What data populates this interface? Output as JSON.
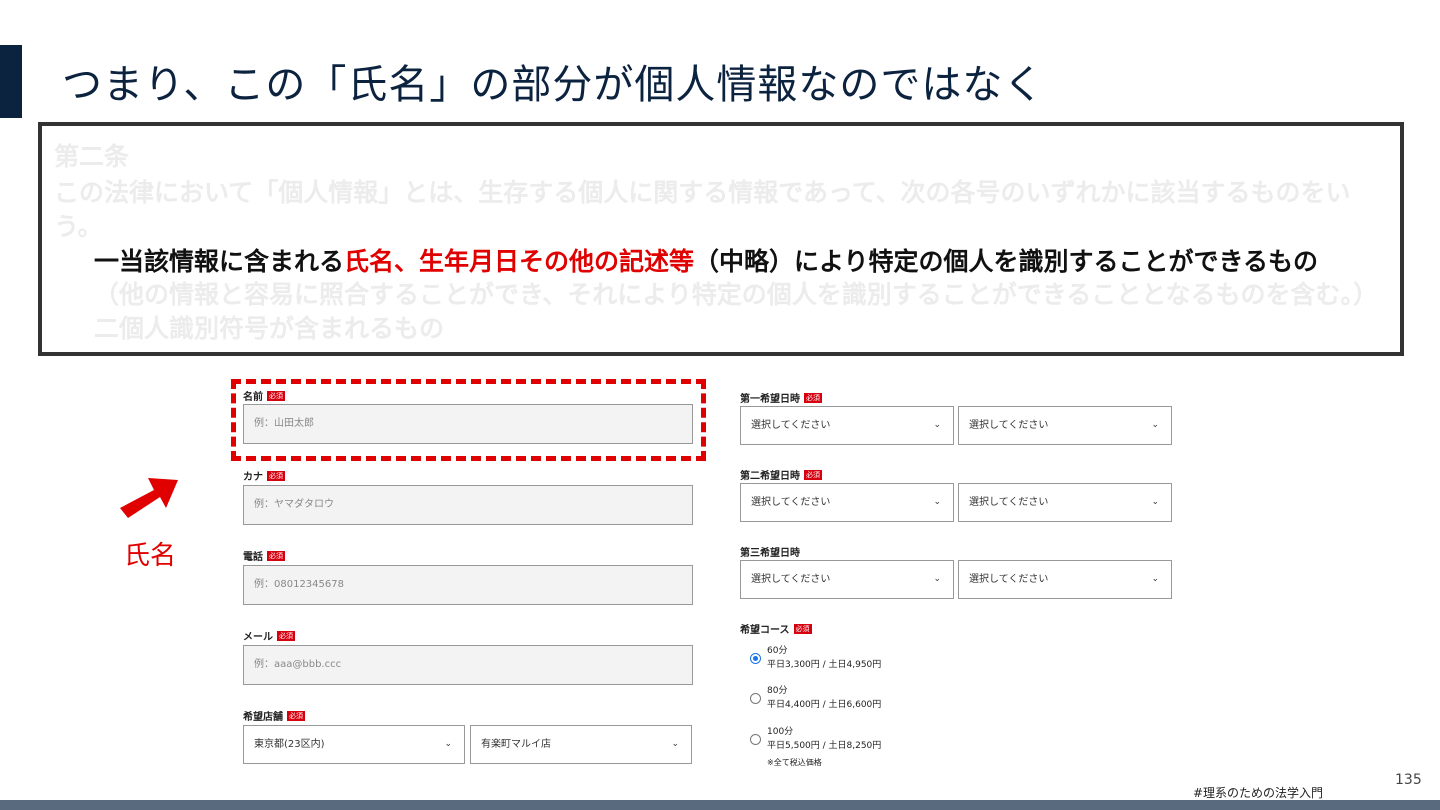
{
  "slide": {
    "title": "つまり、この「氏名」の部分が個人情報なのではなく",
    "page_number": "135",
    "hashtag": "#理系のための法学入門"
  },
  "law": {
    "article": "第二条",
    "definition": "この法律において「個人情報」とは、生存する個人に関する情報であって、次の各号のいずれかに該当するものをいう。",
    "item1_prefix": "一当該情報に含まれる",
    "item1_highlight": "氏名、生年月日その他の記述等",
    "item1_suffix": "（中略）により特定の個人を識別することができるもの",
    "item1_paren": "（他の情報と容易に照合することができ、それにより特定の個人を識別することができることとなるものを含む。）",
    "item2": "二個人識別符号が含まれるもの"
  },
  "annotation": {
    "caption": "氏名",
    "color": "#e00000"
  },
  "form": {
    "required_badge": "必須",
    "name": {
      "label": "名前",
      "placeholder": "例：山田太郎"
    },
    "kana": {
      "label": "カナ",
      "placeholder": "例：ヤマダタロウ"
    },
    "phone": {
      "label": "電話",
      "placeholder": "例：08012345678"
    },
    "email": {
      "label": "メール",
      "placeholder": "例：aaa@bbb.ccc"
    },
    "store": {
      "label": "希望店舗",
      "area": "東京都(23区内)",
      "branch": "有楽町マルイ店"
    },
    "schedule": [
      {
        "label": "第一希望日時",
        "required": true,
        "date": "選択してください",
        "time": "選択してください"
      },
      {
        "label": "第二希望日時",
        "required": true,
        "date": "選択してください",
        "time": "選択してください"
      },
      {
        "label": "第三希望日時",
        "required": false,
        "date": "選択してください",
        "time": "選択してください"
      }
    ],
    "course": {
      "label": "希望コース",
      "options": [
        {
          "time": "60分",
          "price": "平日3,300円 / 土日4,950円",
          "selected": true
        },
        {
          "time": "80分",
          "price": "平日4,400円 / 土日6,600円",
          "selected": false
        },
        {
          "time": "100分",
          "price": "平日5,500円 / 土日8,250円",
          "selected": false
        }
      ],
      "note": "※全て税込価格"
    }
  }
}
